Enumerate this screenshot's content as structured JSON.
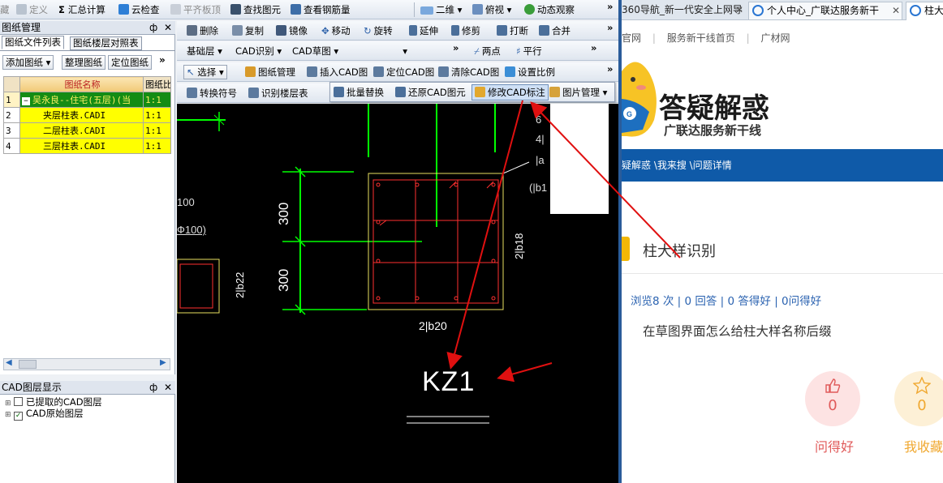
{
  "app": {
    "toolbar1": {
      "hide": "藏",
      "define": "定义",
      "sum": "汇总计算",
      "cloud_check": "云检查",
      "flat_slab": "平齐板顶",
      "find": "查找图元",
      "view_rebar": "查看钢筋量",
      "view_mode": "二维",
      "view_dir": "俯视",
      "dynamic": "动态观察"
    },
    "toolbar2": {
      "delete": "删除",
      "copy": "复制",
      "mirror": "镜像",
      "move": "移动",
      "rotate": "旋转",
      "extend": "延伸",
      "trim": "修剪",
      "break": "打断",
      "merge": "合并"
    },
    "toolbar3": {
      "layer": "基础层",
      "cad_recognize": "CAD识别",
      "cad_sketch": "CAD草图",
      "empty": "",
      "two_point": "两点",
      "parallel": "平行"
    },
    "toolbar4": {
      "select": "选择",
      "drawing_mgmt": "图纸管理",
      "insert_cad": "插入CAD图",
      "locate_cad": "定位CAD图",
      "clear_cad": "清除CAD图",
      "set_scale": "设置比例"
    },
    "toolbar5": {
      "convert_symbol": "转换符号",
      "recognize_floor": "识别楼层表",
      "batch_replace": "批量替换",
      "restore_cad": "还原CAD图元",
      "modify_cad_label": "修改CAD标注",
      "image_mgmt": "图片管理"
    },
    "drawing_panel": {
      "title": "图纸管理",
      "pin": "ф",
      "close": "✕",
      "tabs": [
        "图纸文件列表",
        "图纸楼层对照表"
      ],
      "buttons": {
        "add": "添加图纸",
        "organize": "整理图纸",
        "locate": "定位图纸",
        "more": "»"
      },
      "columns": [
        "图纸名称",
        "图纸比"
      ],
      "rows": [
        {
          "num": "1",
          "name": "吴永良--住宅(五层)(当",
          "ratio": "1:1",
          "level": 0
        },
        {
          "num": "2",
          "name": "夹层柱表.CADI",
          "ratio": "1:1",
          "level": 1
        },
        {
          "num": "3",
          "name": "二层柱表.CADI",
          "ratio": "1:1",
          "level": 1
        },
        {
          "num": "4",
          "name": "三层柱表.CADI",
          "ratio": "1:1",
          "level": 1
        }
      ]
    },
    "layer_panel": {
      "title": "CAD图层显示",
      "pin": "ф",
      "close": "✕",
      "items": [
        {
          "label": "已提取的CAD图层",
          "checked": false
        },
        {
          "label": "CAD原始图层",
          "checked": true
        }
      ]
    },
    "cad": {
      "dim_300_top": "300",
      "dim_300_bottom": "300",
      "label_100": "100",
      "label_0100": "Ф100)",
      "label_2b22": "2|b22",
      "label_2b18": "2|b18",
      "label_2b20": "2|b20",
      "label_kz1": "KZ1",
      "partial_6": "6",
      "partial_4": "4|",
      "partial_a": "|a",
      "partial_b1": "(|b1"
    }
  },
  "browser": {
    "tabs": [
      {
        "title": "360导航_新一代安全上网导",
        "close": "✕"
      },
      {
        "title": "个人中心_广联达服务新干",
        "close": "✕"
      },
      {
        "title": "柱大",
        "close": ""
      }
    ],
    "nav_links": [
      "官网",
      "服务新干线首页",
      "广材网"
    ],
    "logo": {
      "title": "答疑解惑",
      "subtitle": "广联达服务新干线"
    },
    "breadcrumb": "疑解惑 \\我来搜 \\问题详情",
    "question_title": "柱大样识别",
    "stats": "浏览8 次 | 0 回答 | 0 答得好 | 0问得好",
    "question_body": "在草图界面怎么给柱大样名称后缀",
    "actions": [
      {
        "count": "0",
        "label": "问得好",
        "icon": "thumbs-up-icon"
      },
      {
        "count": "0",
        "label": "我收藏",
        "icon": "star-icon"
      }
    ]
  }
}
